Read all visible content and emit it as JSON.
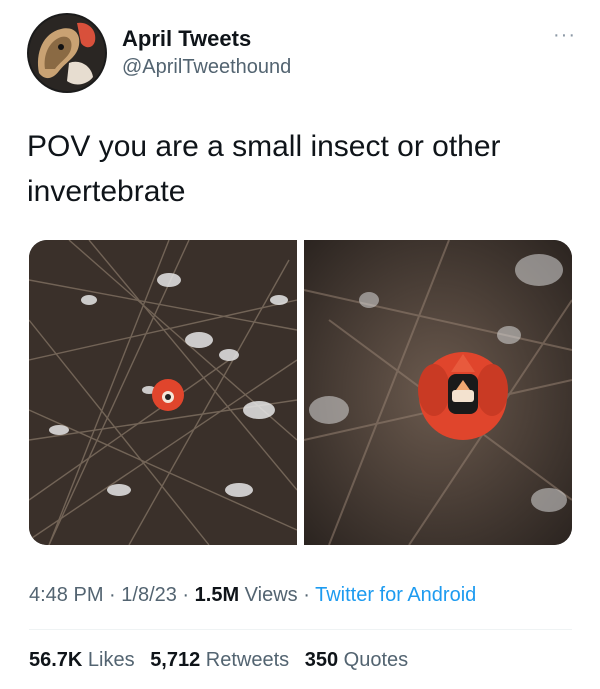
{
  "user": {
    "display_name": "April Tweets",
    "handle": "@AprilTweethound",
    "avatar_icon": "hound-avatar"
  },
  "more_icon": "ellipsis-icon",
  "tweet": {
    "text": "POV you are a small insect or other invertebrate"
  },
  "media": {
    "count": 2,
    "subject": "cardinal-bird-photo"
  },
  "meta": {
    "time": "4:48 PM",
    "sep1": " · ",
    "date": "1/8/23",
    "sep2": " · ",
    "views_count": "1.5M",
    "views_label": " Views",
    "sep3": " · ",
    "source": "Twitter for Android"
  },
  "stats": {
    "likes_count": "56.7K",
    "likes_label": " Likes",
    "retweets_count": "5,712",
    "retweets_label": " Retweets",
    "quotes_count": "350",
    "quotes_label": " Quotes"
  },
  "colors": {
    "text": "#0f1419",
    "secondary": "#536471",
    "link": "#1d9bf0",
    "cardinal": "#e0452c"
  }
}
